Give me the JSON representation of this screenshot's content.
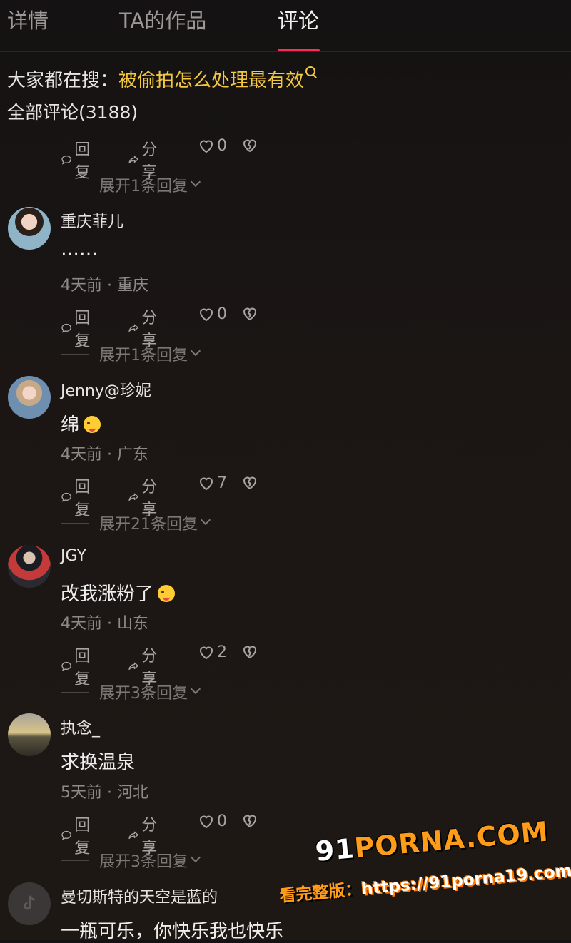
{
  "tabs": [
    {
      "label": "详情"
    },
    {
      "label": "TA的作品"
    },
    {
      "label": "评论"
    }
  ],
  "hot_search": {
    "prefix": "大家都在搜：",
    "keyword": "被偷拍怎么处理最有效"
  },
  "total_comments": "全部评论(3188)",
  "top_actions": {
    "reply": "回复",
    "share": "分享",
    "likes": "0",
    "expand": "展开1条回复"
  },
  "comments": [
    {
      "name": "重庆菲儿",
      "text": "……",
      "time": "4天前 · 重庆",
      "reply": "回复",
      "share": "分享",
      "likes": "0",
      "expand": "展开1条回复"
    },
    {
      "name": "Jenny@珍妮",
      "text": "绵",
      "time": "4天前 · 广东",
      "reply": "回复",
      "share": "分享",
      "likes": "7",
      "expand": "展开21条回复"
    },
    {
      "name": "JGY",
      "text": "改我涨粉了",
      "time": "4天前 · 山东",
      "reply": "回复",
      "share": "分享",
      "likes": "2",
      "expand": "展开3条回复"
    },
    {
      "name": "执念_",
      "text": "求换温泉",
      "time": "5天前 · 河北",
      "reply": "回复",
      "share": "分享",
      "likes": "0",
      "expand": "展开3条回复"
    },
    {
      "name": "曼切斯特的天空是蓝的",
      "text": "一瓶可乐，你快乐我也快乐"
    }
  ],
  "watermark": {
    "logo_num": "91",
    "logo_text": "PORNA.COM",
    "url_lead": "看完整版：",
    "url": "https://91porna19.com"
  },
  "colors": {
    "accent": "#fe2c55",
    "keyword": "#f5c842",
    "background": "#1b1614"
  }
}
